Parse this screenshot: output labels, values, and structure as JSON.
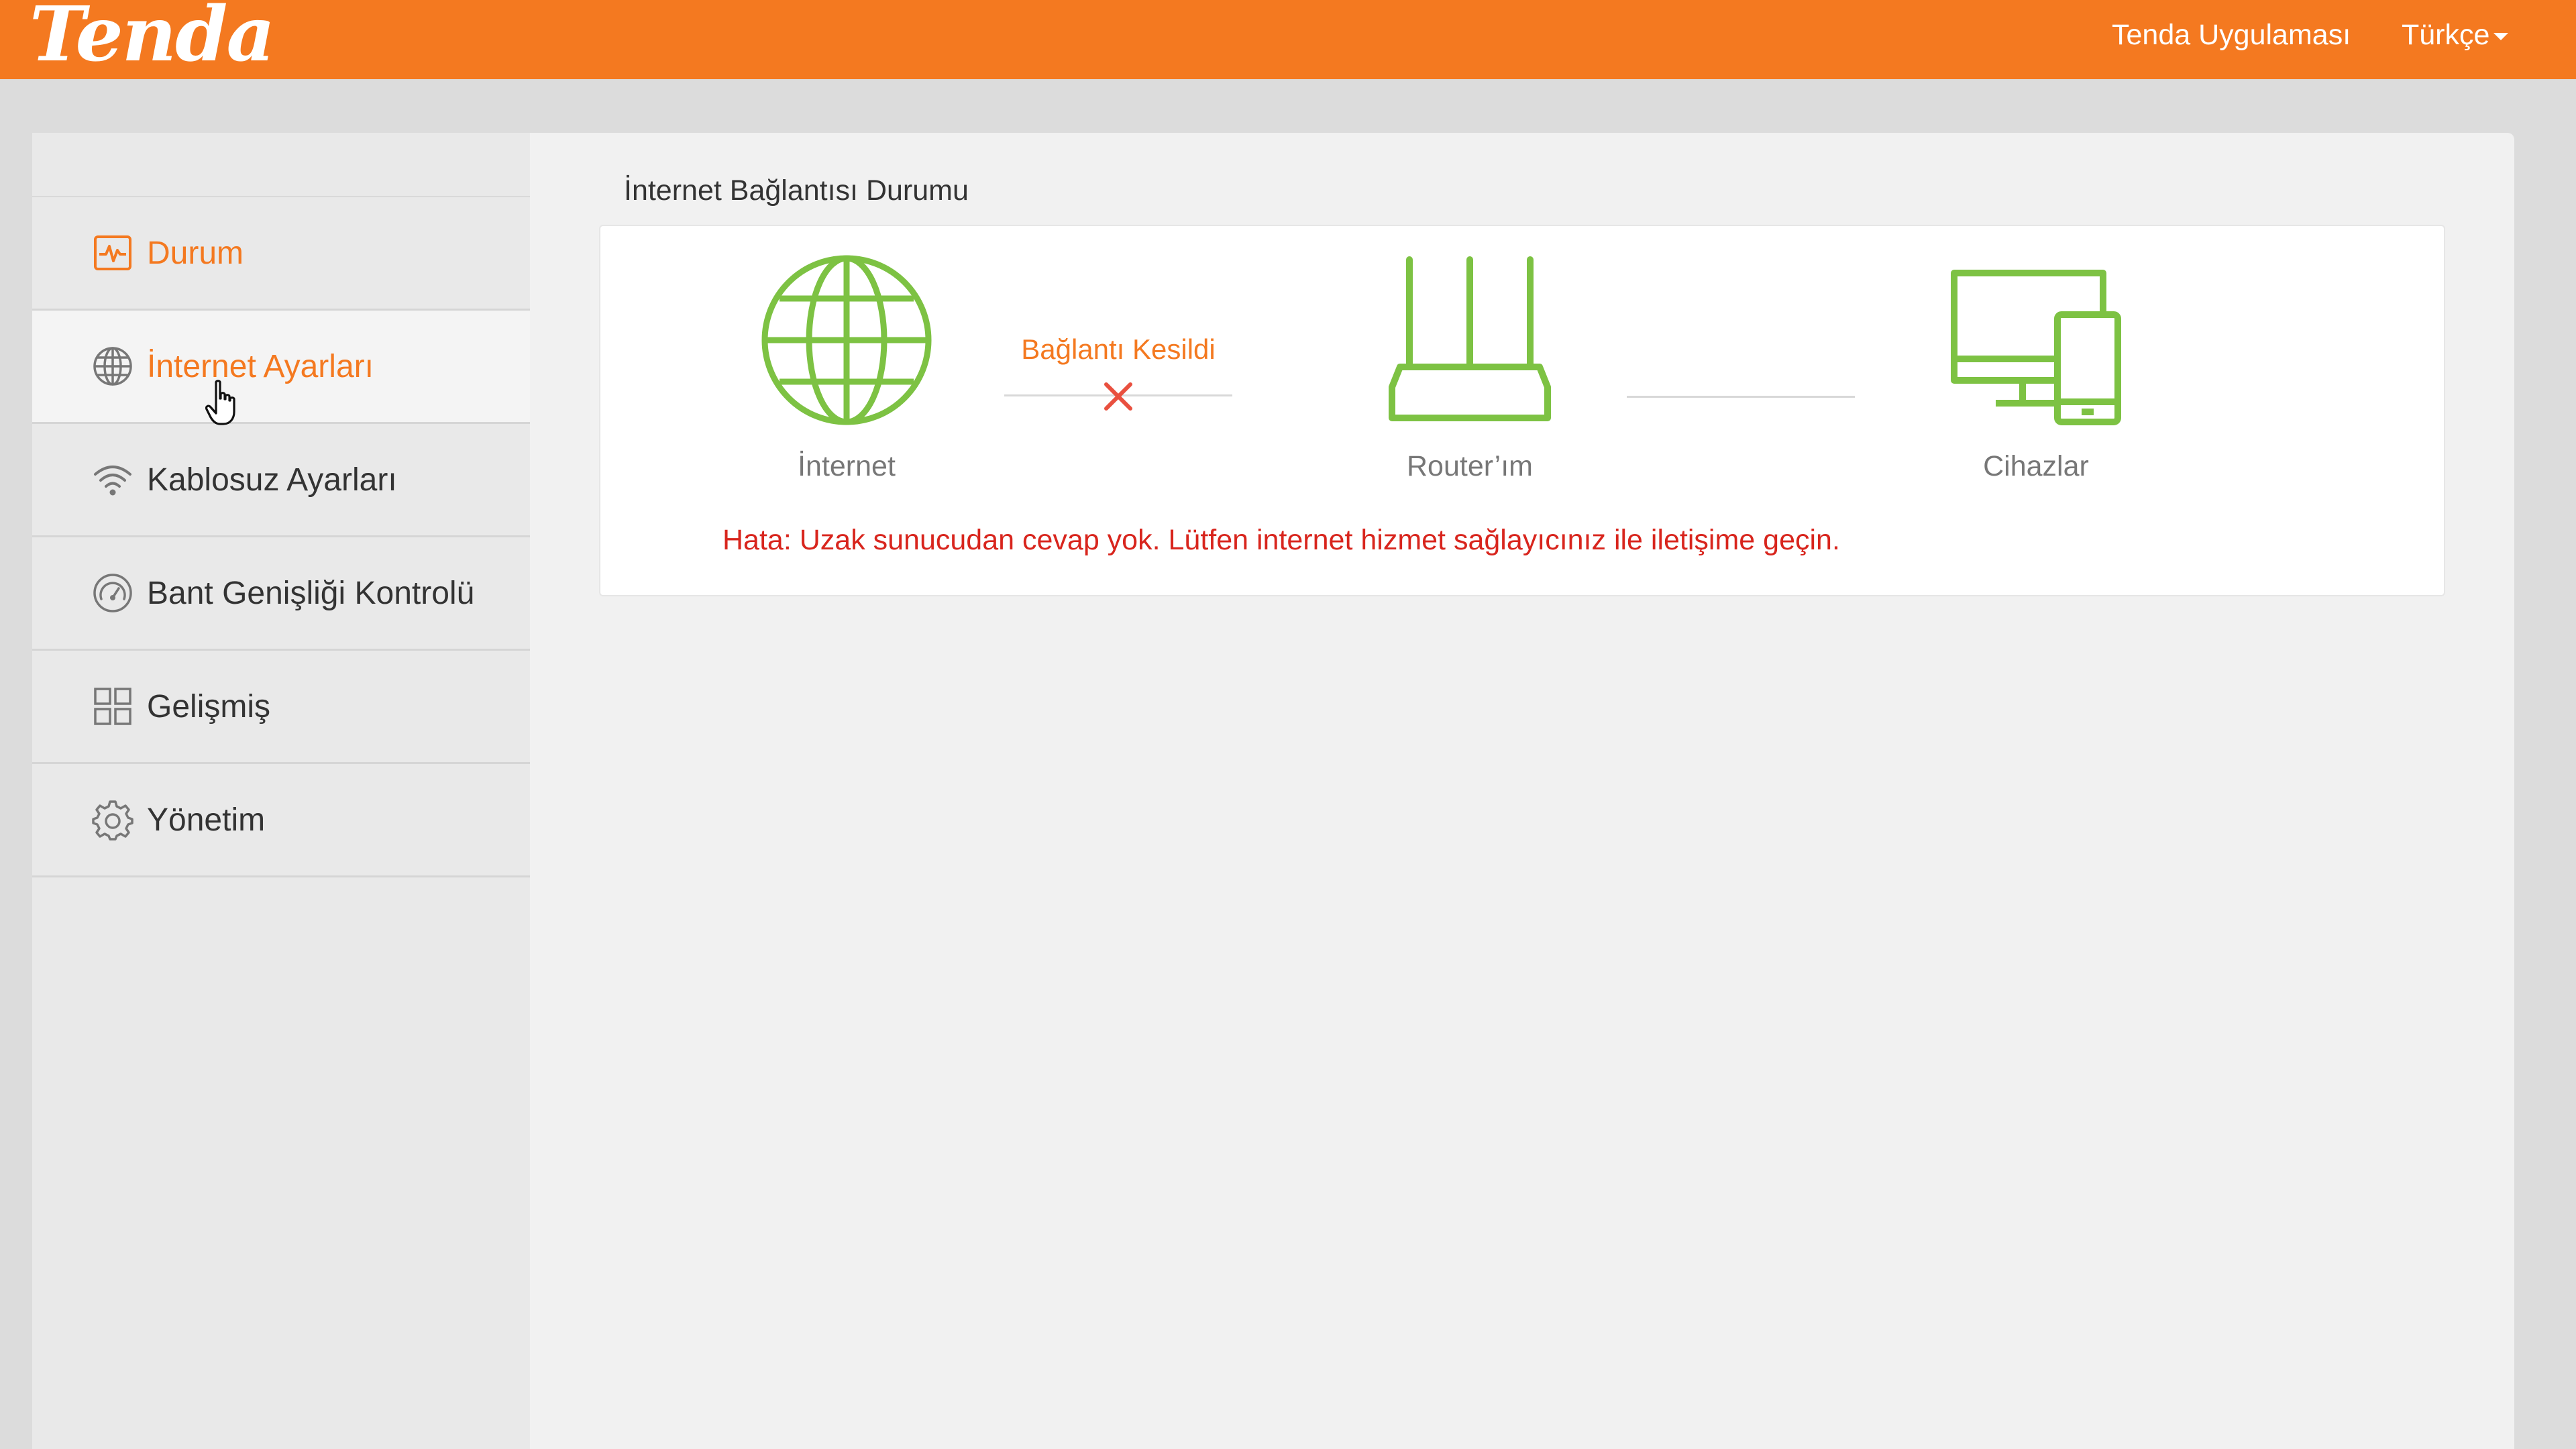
{
  "header": {
    "logo": "Tenda",
    "app_link": "Tenda Uygulaması",
    "language": "Türkçe"
  },
  "sidebar": {
    "items": [
      {
        "label": "Durum",
        "icon": "status-pulse-icon"
      },
      {
        "label": "İnternet Ayarları",
        "icon": "globe-icon"
      },
      {
        "label": "Kablosuz Ayarları",
        "icon": "wifi-icon"
      },
      {
        "label": "Bant Genişliği Kontrolü",
        "icon": "speedometer-icon"
      },
      {
        "label": "Gelişmiş",
        "icon": "grid-icon"
      },
      {
        "label": "Yönetim",
        "icon": "gear-icon"
      }
    ]
  },
  "main": {
    "title": "İnternet Bağlantısı Durumu",
    "internet_label": "İnternet",
    "connection_status": "Bağlantı Kesildi",
    "router_label": "Router’ım",
    "devices_label": "Cihazlar",
    "error": "Hata: Uzak sunucudan cevap yok. Lütfen internet hizmet sağlayıcınız ile iletişime geçin."
  },
  "colors": {
    "brand": "#f47920",
    "icon_green": "#7dc243",
    "error_red": "#d8251d"
  }
}
